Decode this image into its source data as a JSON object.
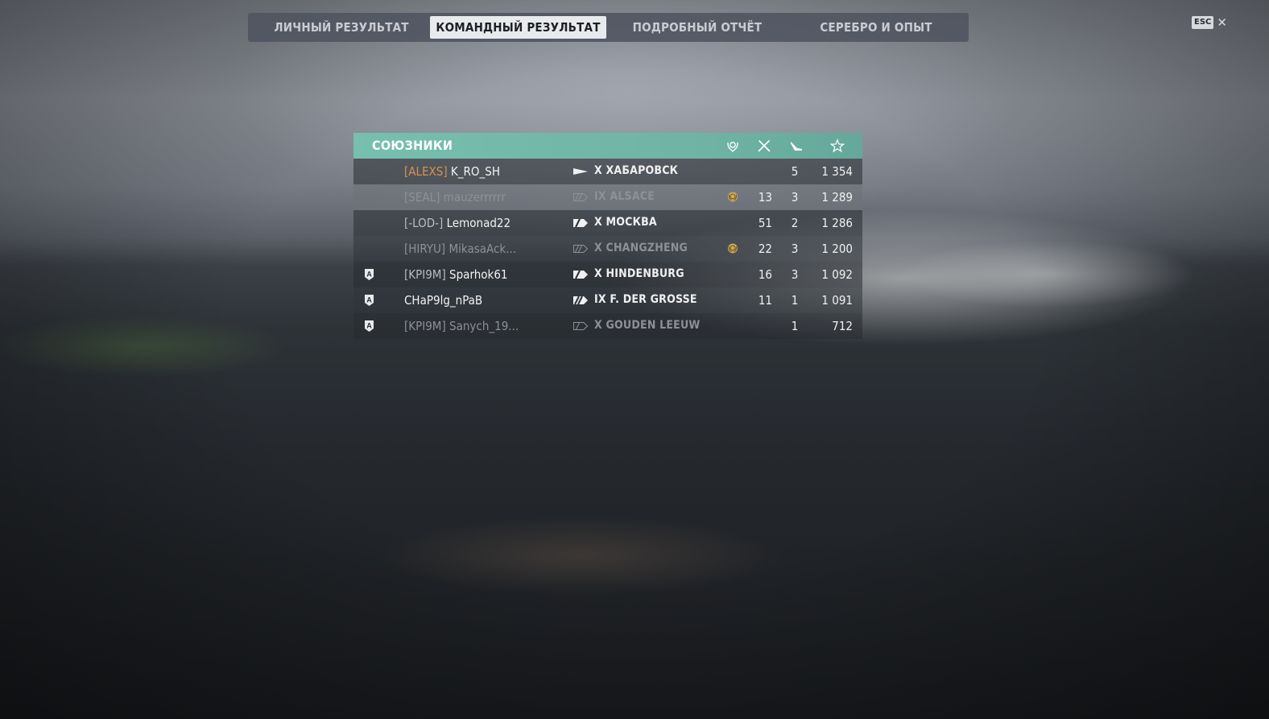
{
  "tabs": [
    {
      "label": "ЛИЧНЫЙ РЕЗУЛЬТАТ",
      "active": false
    },
    {
      "label": "КОМАНДНЫЙ РЕЗУЛЬТАТ",
      "active": true
    },
    {
      "label": "ПОДРОБНЫЙ ОТЧЁТ",
      "active": false
    },
    {
      "label": "СЕРЕБРО И ОПЫТ",
      "active": false
    }
  ],
  "close": {
    "key": "ESC",
    "symbol": "✕"
  },
  "team": {
    "title": "СОЮЗНИКИ",
    "column_icons": [
      "laurel-medal-icon",
      "crossed-swords-icon",
      "hit-icon",
      "star-icon"
    ],
    "accent_color": "#72b8a8",
    "rows": [
      {
        "division": "",
        "clan": "[ALEXS]",
        "name": "K_RO_SH",
        "tier_ship": "X ХАБАРОВСК",
        "ship_class": "destroyer",
        "medal": false,
        "col1": "",
        "col2": "5",
        "col3": "1 354",
        "self": true,
        "dead": false
      },
      {
        "division": "",
        "clan": "[SEAL]",
        "name": "mauzerrrrrr",
        "tier_ship": "IX ALSACE",
        "ship_class": "battleship",
        "medal": true,
        "col1": "13",
        "col2": "3",
        "col3": "1 289",
        "self": false,
        "dead": true
      },
      {
        "division": "",
        "clan": "[-LOD-]",
        "name": "Lemonad22",
        "tier_ship": "X МОСКВА",
        "ship_class": "cruiser",
        "medal": false,
        "col1": "51",
        "col2": "2",
        "col3": "1 286",
        "self": false,
        "dead": false
      },
      {
        "division": "",
        "clan": "[HIRYU]",
        "name": "MikasaAck...",
        "tier_ship": "X CHANGZHENG",
        "ship_class": "battleship",
        "medal": true,
        "col1": "22",
        "col2": "3",
        "col3": "1 200",
        "self": false,
        "dead": true
      },
      {
        "division": "A",
        "clan": "[KPI9M]",
        "name": "Sparhok61",
        "tier_ship": "X HINDENBURG",
        "ship_class": "cruiser",
        "medal": false,
        "col1": "16",
        "col2": "3",
        "col3": "1 092",
        "self": false,
        "dead": false
      },
      {
        "division": "A",
        "clan": "",
        "name": "CHaP9lg_nPaB",
        "tier_ship": "IX F. DER GROSSE",
        "ship_class": "battleship",
        "medal": false,
        "col1": "11",
        "col2": "1",
        "col3": "1 091",
        "self": false,
        "dead": false
      },
      {
        "division": "A",
        "clan": "[KPI9M]",
        "name": "Sanych_19...",
        "tier_ship": "X GOUDEN LEEUW",
        "ship_class": "cruiser",
        "medal": false,
        "col1": "",
        "col2": "1",
        "col3": "712",
        "self": false,
        "dead": true
      }
    ]
  },
  "colors": {
    "self_clan": "#d9924f",
    "medal_gold": "#d6b256",
    "dead_text": "#8d9096"
  }
}
